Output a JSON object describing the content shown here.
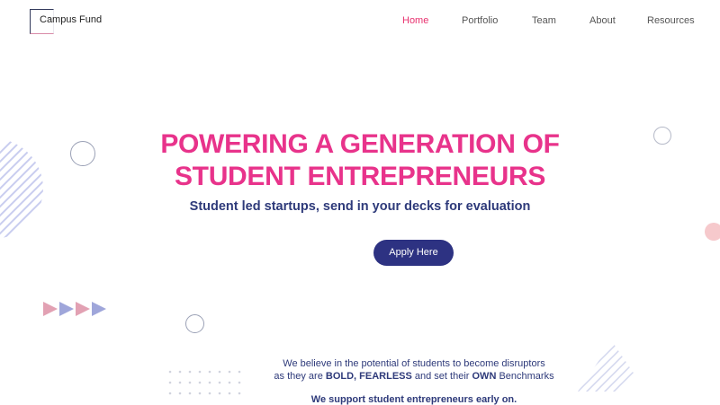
{
  "nav": {
    "logo_text": "Campus Fund",
    "items": [
      {
        "label": "Home",
        "active": true
      },
      {
        "label": "Portfolio",
        "active": false
      },
      {
        "label": "Team",
        "active": false
      },
      {
        "label": "About",
        "active": false
      },
      {
        "label": "Resources",
        "active": false
      }
    ]
  },
  "hero": {
    "title_line1": "POWERING A GENERATION OF",
    "title_line2": "STUDENT ENTREPRENEURS",
    "subtitle": "Student led startups, send in your decks for evaluation",
    "apply_label": "Apply Here"
  },
  "about": {
    "line1": "We believe in the potential of students to become disruptors",
    "line2_prefix": "as they are ",
    "line2_bold1": "BOLD, FEARLESS",
    "line2_mid": " and set their ",
    "line2_bold2": "OWN",
    "line2_suffix": " Benchmarks",
    "support_line": "We support student entrepreneurs early on."
  },
  "colors": {
    "accent_pink": "#e8338b",
    "navy": "#2d3282",
    "active_nav": "#e8306e"
  }
}
